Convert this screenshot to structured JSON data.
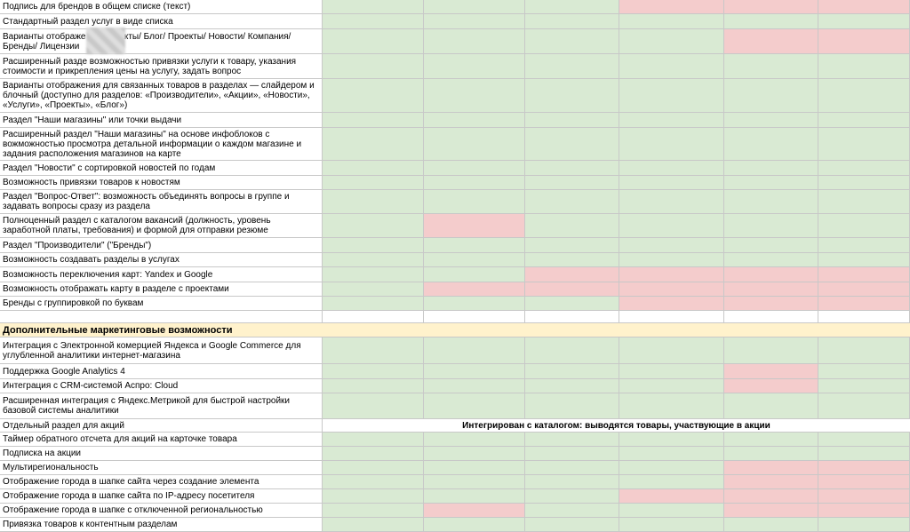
{
  "sheet": {
    "palette": {
      "green": "#d9ead3",
      "red": "#f4cccc",
      "white": "#ffffff",
      "section": "#fff2cc",
      "grid": "#c8c8c8"
    },
    "rows": [
      {
        "label": "Подпись для брендов в общем списке (текст)",
        "cells": [
          "g",
          "g",
          "g",
          "r",
          "r",
          "r"
        ]
      },
      {
        "label": "Стандартный раздел услуг в виде списка",
        "cells": [
          "g",
          "g",
          "g",
          "g",
          "g",
          "g"
        ]
      },
      {
        "label": "Варианты отображе[скрыто]ов Контакты/ Блог/ Проекты/ Новости/ Компания/ Бренды/ [скрыто] Лицензии",
        "cells": [
          "g",
          "g",
          "g",
          "g",
          "r",
          "r"
        ],
        "redacted": true
      },
      {
        "label": "Расширенный разде[скрыто] возможностью привязки услуги к товару, указания стоимости и прикрепления цены на услугу, задать вопрос",
        "cells": [
          "g",
          "g",
          "g",
          "g",
          "g",
          "g"
        ]
      },
      {
        "label": "Варианты отображения для связанных товаров в разделах — слайдером и блочный (доступно для разделов: «Производители», «Акции», «Новости», «Услуги», «Проекты», «Блог»)",
        "cells": [
          "g",
          "g",
          "g",
          "g",
          "g",
          "g"
        ]
      },
      {
        "label": "Раздел \"Наши магазины\" или точки выдачи",
        "cells": [
          "g",
          "g",
          "g",
          "g",
          "g",
          "g"
        ]
      },
      {
        "label": "Расширенный раздел \"Наши магазины\" на основе инфоблоков с вожможностью просмотра детальной информации о каждом магазине и задания расположения магазинов на карте",
        "cells": [
          "g",
          "g",
          "g",
          "g",
          "g",
          "g"
        ]
      },
      {
        "label": "Раздел \"Новости\" с сортировкой новостей по годам",
        "cells": [
          "g",
          "g",
          "g",
          "g",
          "g",
          "g"
        ]
      },
      {
        "label": "Возможность привязки товаров к новостям",
        "cells": [
          "g",
          "g",
          "g",
          "g",
          "g",
          "g"
        ]
      },
      {
        "label": "Раздел \"Вопрос-Ответ\": возможность объединять вопросы в группе и задавать вопросы сразу из раздела",
        "cells": [
          "g",
          "g",
          "g",
          "g",
          "g",
          "g"
        ]
      },
      {
        "label": "Полноценный раздел с каталогом вакансий (должность, уровень заработной платы, требования) и формой для отправки резюме",
        "cells": [
          "g",
          "r",
          "g",
          "g",
          "g",
          "g"
        ]
      },
      {
        "label": "Раздел \"Производители\" (\"Бренды\")",
        "cells": [
          "g",
          "g",
          "g",
          "g",
          "g",
          "g"
        ]
      },
      {
        "label": "Возможность создавать разделы в услугах",
        "cells": [
          "g",
          "g",
          "g",
          "g",
          "g",
          "g"
        ]
      },
      {
        "label": "Возможность переключения карт: Yandex и Google",
        "cells": [
          "g",
          "g",
          "r",
          "r",
          "r",
          "r"
        ]
      },
      {
        "label": "Возможность отображать карту в разделе с проектами",
        "cells": [
          "g",
          "r",
          "r",
          "r",
          "r",
          "r"
        ]
      },
      {
        "label": "Бренды с группировкой по буквам",
        "cells": [
          "g",
          "g",
          "g",
          "r",
          "r",
          "r"
        ]
      },
      {
        "label": "",
        "cells": [
          "w",
          "w",
          "w",
          "w",
          "w",
          "w"
        ]
      },
      {
        "section": "Дополнительные маркетинговые возможности"
      },
      {
        "label": "Интеграция с Электронной комерцией Яндекса и Google Commerce для углубленной аналитики интернет-магазина",
        "cells": [
          "g",
          "g",
          "g",
          "g",
          "g",
          "g"
        ]
      },
      {
        "label": "Поддержка Google Analytics 4",
        "cells": [
          "g",
          "g",
          "g",
          "g",
          "r",
          "g"
        ]
      },
      {
        "label": "Интеграция с CRM-системой Аспро: Cloud",
        "cells": [
          "g",
          "g",
          "g",
          "g",
          "r",
          "g"
        ]
      },
      {
        "label": "Расширенная интеграция с Яндекс.Метрикой для быстрой настройки базовой системы аналитики",
        "cells": [
          "g",
          "g",
          "g",
          "g",
          "g",
          "g"
        ]
      },
      {
        "label": "Отдельный раздел для акций",
        "merged_note": "Интегрирован с каталогом: выводятся товары, участвующие в акции"
      },
      {
        "label": "Таймер обратного отсчета для акций на карточке товара",
        "cells": [
          "g",
          "g",
          "g",
          "g",
          "g",
          "g"
        ]
      },
      {
        "label": "Подписка на акции",
        "cells": [
          "g",
          "g",
          "g",
          "g",
          "g",
          "g"
        ]
      },
      {
        "label": "Мультирегиональность",
        "cells": [
          "g",
          "g",
          "g",
          "g",
          "r",
          "r"
        ]
      },
      {
        "label": "Отображение города в шапке сайта через создание элемента",
        "cells": [
          "g",
          "g",
          "g",
          "g",
          "r",
          "r"
        ]
      },
      {
        "label": "Отображение города в шапке сайта по IP-адресу посетителя",
        "cells": [
          "g",
          "g",
          "g",
          "r",
          "r",
          "r"
        ]
      },
      {
        "label": "Отображение города в шапке с отключенной региональностью",
        "cells": [
          "g",
          "r",
          "g",
          "g",
          "r",
          "r"
        ]
      },
      {
        "label": "Привязка товаров к контентным разделам",
        "cells": [
          "g",
          "g",
          "g",
          "g",
          "g",
          "g"
        ]
      }
    ]
  }
}
